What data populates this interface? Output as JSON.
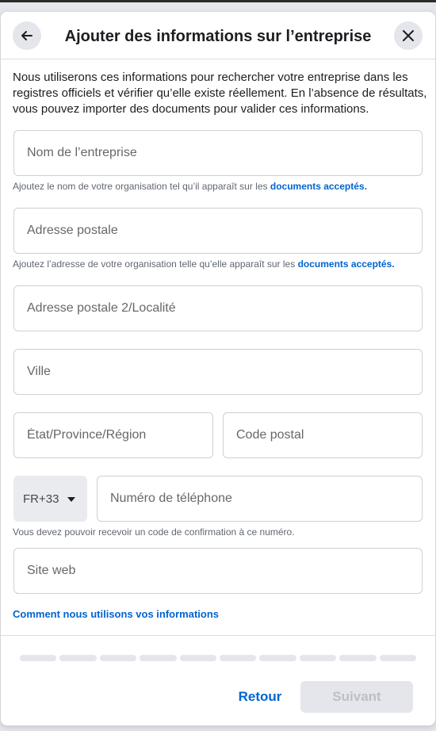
{
  "dialog": {
    "title": "Ajouter des informations sur l’entreprise",
    "intro": "Nous utiliserons ces informations pour rechercher votre entreprise dans les registres officiels et vérifier qu’elle existe réellement. En l’absence de résultats, vous pouvez importer des documents pour valider ces informations."
  },
  "icons": {
    "back": "arrow-left-icon",
    "close": "close-icon",
    "caret": "caret-down-icon"
  },
  "form": {
    "company_name": {
      "placeholder": "Nom de l’entreprise",
      "value": ""
    },
    "company_name_hint": {
      "text": "Ajoutez le nom de votre organisation tel qu’il apparaît sur les",
      "link": "documents acceptés."
    },
    "address": {
      "placeholder": "Adresse postale",
      "value": ""
    },
    "address_hint": {
      "text": "Ajoutez l’adresse de votre organisation telle qu’elle apparaît sur les",
      "link": "documents acceptés."
    },
    "address2": {
      "placeholder": "Adresse postale 2/Localité",
      "value": ""
    },
    "city": {
      "placeholder": "Ville",
      "value": ""
    },
    "state": {
      "placeholder": "État/Province/Région",
      "value": ""
    },
    "postal_code": {
      "placeholder": "Code postal",
      "value": ""
    },
    "country_code": "FR+33",
    "phone": {
      "placeholder": "Numéro de téléphone",
      "value": ""
    },
    "phone_hint": "Vous devez pouvoir recevoir un code de confirmation à ce numéro.",
    "website": {
      "placeholder": "Site web",
      "value": ""
    }
  },
  "footer": {
    "info_link": "Comment nous utilisons vos informations",
    "progress": {
      "total_steps": 10,
      "completed_steps": 0
    },
    "back_label": "Retour",
    "next_label": "Suivant"
  },
  "colors": {
    "accent": "#0064d1",
    "border": "#ccd0d5",
    "disabled_bg": "#e4e6eb",
    "disabled_text": "#bcc0c4"
  }
}
